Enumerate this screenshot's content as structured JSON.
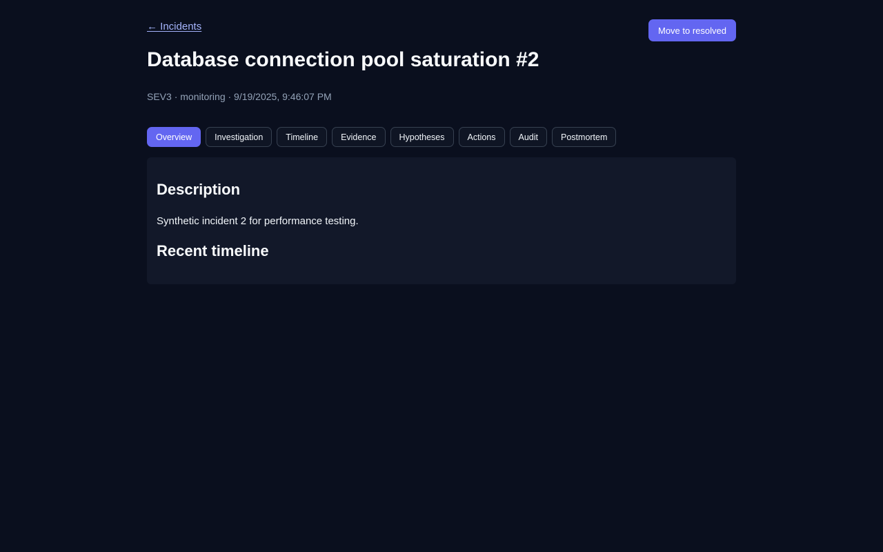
{
  "header": {
    "back_link": "← Incidents",
    "action_button": "Move to resolved"
  },
  "incident": {
    "title": "Database connection pool saturation #2",
    "meta": "SEV3 · monitoring · 9/19/2025, 9:46:07 PM"
  },
  "tabs": [
    {
      "label": "Overview",
      "active": true
    },
    {
      "label": "Investigation",
      "active": false
    },
    {
      "label": "Timeline",
      "active": false
    },
    {
      "label": "Evidence",
      "active": false
    },
    {
      "label": "Hypotheses",
      "active": false
    },
    {
      "label": "Actions",
      "active": false
    },
    {
      "label": "Audit",
      "active": false
    },
    {
      "label": "Postmortem",
      "active": false
    }
  ],
  "overview": {
    "description_heading": "Description",
    "description_text": "Synthetic incident 2 for performance testing.",
    "timeline_heading": "Recent timeline"
  },
  "colors": {
    "background": "#0a0f1e",
    "panel": "#121829",
    "accent": "#6366f1",
    "link": "#a5b4fc",
    "muted_text": "#94a3b8"
  }
}
